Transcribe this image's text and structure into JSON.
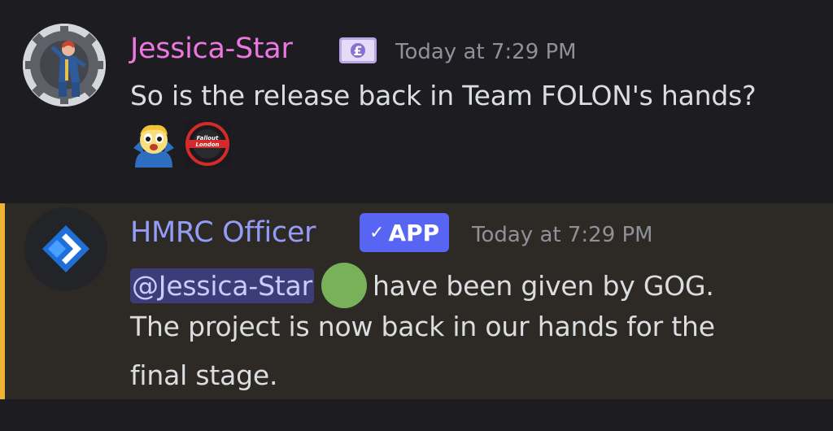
{
  "messages": [
    {
      "username": "Jessica-Star",
      "username_color": "#ed77e0",
      "role_icon": "banknote-icon",
      "timestamp": "Today at 7:29 PM",
      "content": "So is the release back in Team FOLON's hands?",
      "reactions": [
        {
          "icon": "vault-boy-emoji"
        },
        {
          "icon": "fallout-london-emoji",
          "label": "Fallout London"
        }
      ]
    },
    {
      "username": "HMRC Officer",
      "username_color": "#949cf7",
      "badge": {
        "check": "✓",
        "label": "APP"
      },
      "timestamp": "Today at 7:29 PM",
      "mention": "@Jessica-Star",
      "inline_emoji": "green-circle-emoji",
      "lines": [
        "have been given by GOG.",
        "The project is now back in our hands for the",
        "final stage."
      ],
      "highlight_color": "#f0b232"
    }
  ]
}
